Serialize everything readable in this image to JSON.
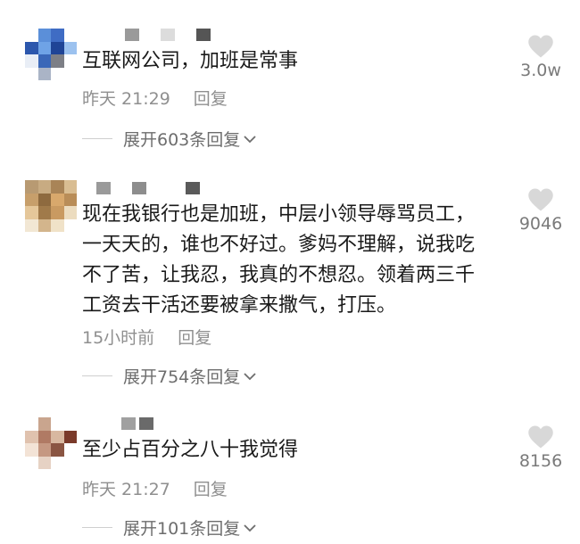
{
  "comments": [
    {
      "text": "互联网公司，加班是常事",
      "time": "昨天 21:29",
      "reply_label": "回复",
      "likes": "3.0w",
      "expand_label": "展开603条回复"
    },
    {
      "text": "现在我银行也是加班，中层小领导辱骂员工，\n一天天的，谁也不好过。爹妈不理解，说我吃\n不了苦，让我忍，我真的不想忍。领着两三千\n工资去干活还要被拿来撒气，打压。",
      "time": "15小时前",
      "reply_label": "回复",
      "likes": "9046",
      "expand_label": "展开754条回复"
    },
    {
      "text": "至少占百分之八十我觉得",
      "time": "昨天 21:27",
      "reply_label": "回复",
      "likes": "8156",
      "expand_label": "展开101条回复"
    }
  ],
  "icons": {
    "like": "heart-icon",
    "expand": "chevron-down-icon"
  },
  "colors": {
    "text": "#1a1a1a",
    "meta": "#8f8f8f",
    "like": "#d8d8d8",
    "count": "#7a7a7a"
  }
}
